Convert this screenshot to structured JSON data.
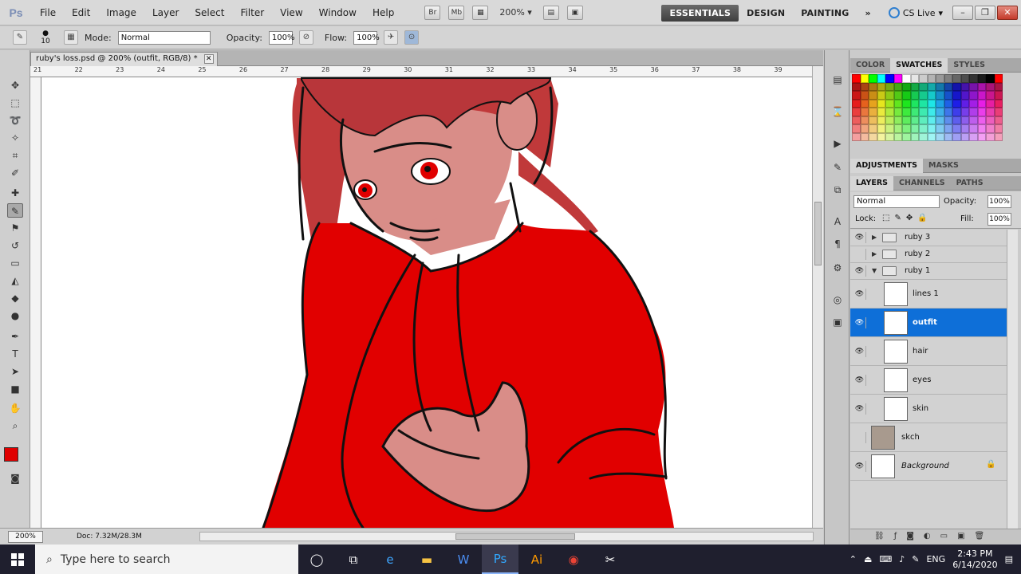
{
  "menubar": {
    "logo": "Ps",
    "items": [
      "File",
      "Edit",
      "Image",
      "Layer",
      "Select",
      "Filter",
      "View",
      "Window",
      "Help"
    ],
    "tool_buttons": [
      "Br",
      "Mb"
    ],
    "zoom": "200%",
    "workspaces": [
      "ESSENTIALS",
      "DESIGN",
      "PAINTING"
    ],
    "more": "»",
    "cs_live": "CS Live"
  },
  "options": {
    "brush_size": "10",
    "mode_label": "Mode:",
    "mode_value": "Normal",
    "opacity_label": "Opacity:",
    "opacity_value": "100%",
    "flow_label": "Flow:",
    "flow_value": "100%"
  },
  "document": {
    "tab_title": "ruby's loss.psd @ 200% (outfit, RGB/8) *",
    "ruler_ticks": [
      "21",
      "22",
      "23",
      "24",
      "25",
      "26",
      "27",
      "28",
      "29",
      "30",
      "31",
      "32",
      "33",
      "34",
      "35",
      "36",
      "37",
      "38",
      "39"
    ],
    "status_zoom": "200%",
    "doc_size": "Doc: 7.32M/28.3M"
  },
  "panels": {
    "top_tabs": [
      "COLOR",
      "SWATCHES",
      "STYLES"
    ],
    "active_top_tab": "SWATCHES",
    "adj_tabs": [
      "ADJUSTMENTS",
      "MASKS"
    ],
    "layer_tabs": [
      "LAYERS",
      "CHANNELS",
      "PATHS"
    ],
    "blend_mode": "Normal",
    "opacity_label": "Opacity:",
    "opacity_value": "100%",
    "lock_label": "Lock:",
    "fill_label": "Fill:",
    "fill_value": "100%",
    "layers": [
      {
        "name": "ruby 3",
        "kind": "group",
        "visible": true
      },
      {
        "name": "ruby 2",
        "kind": "group",
        "visible": false
      },
      {
        "name": "ruby 1",
        "kind": "group",
        "visible": true
      },
      {
        "name": "lines 1",
        "kind": "layer",
        "visible": true
      },
      {
        "name": "outfit",
        "kind": "layer",
        "visible": true,
        "selected": true
      },
      {
        "name": "hair",
        "kind": "layer",
        "visible": true
      },
      {
        "name": "eyes",
        "kind": "layer",
        "visible": true
      },
      {
        "name": "skin",
        "kind": "layer",
        "visible": true
      },
      {
        "name": "skch",
        "kind": "layer",
        "visible": false
      },
      {
        "name": "Background",
        "kind": "background",
        "visible": true
      }
    ]
  },
  "taskbar": {
    "search_placeholder": "Type here to search",
    "lang": "ENG",
    "time": "2:43 PM",
    "date": "6/14/2020"
  },
  "colors": {
    "foreground": "#e00000",
    "selection": "#0e6fd8",
    "outfit_red": "#e10000",
    "skin": "#d98d88",
    "hair": "#c0393a"
  }
}
